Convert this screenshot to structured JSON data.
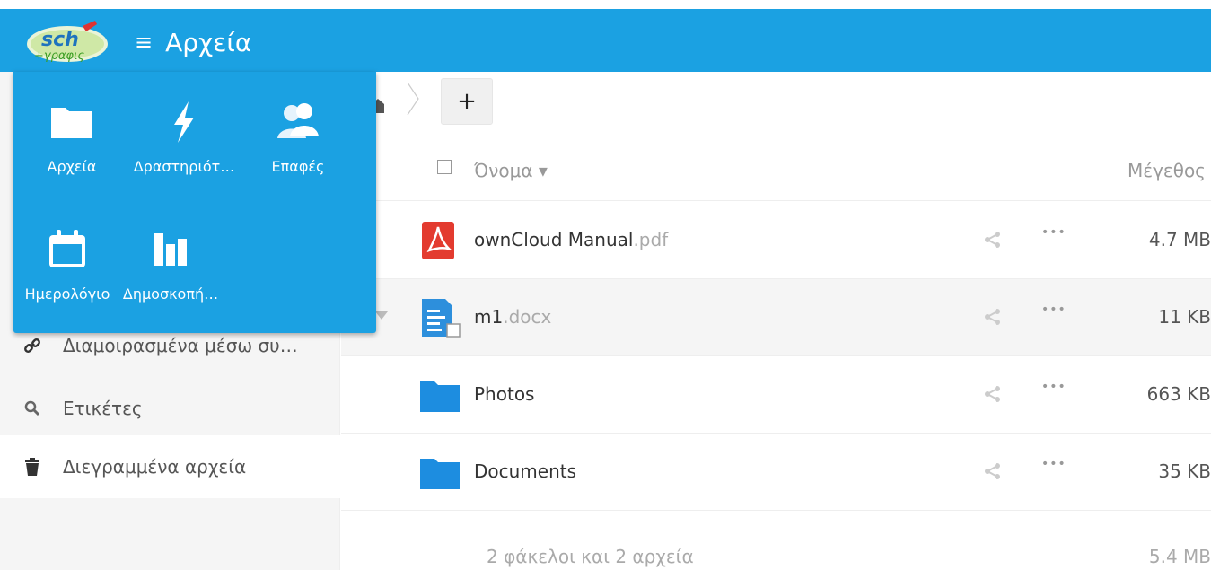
{
  "header": {
    "title": "Αρχεία",
    "menu_icon": "hamburger-icon",
    "logo_text": "sch+γραφις",
    "color": "#1ba1e2"
  },
  "app_menu": {
    "apps": [
      {
        "label": "Αρχεία",
        "icon": "folder-icon"
      },
      {
        "label": "Δραστηριότ…",
        "icon": "lightning-icon"
      },
      {
        "label": "Επαφές",
        "icon": "contacts-icon"
      },
      {
        "label": "Ημερολόγιο",
        "icon": "calendar-icon"
      },
      {
        "label": "Δημοσκοπή…",
        "icon": "poll-icon"
      }
    ]
  },
  "sidebar": {
    "items": [
      {
        "label": "Διαμοιρασμένα μέσω συ…",
        "icon": "link-icon"
      },
      {
        "label": "Ετικέτες",
        "icon": "search-icon"
      },
      {
        "label": "Διεγραμμένα αρχεία",
        "icon": "trash-icon"
      }
    ]
  },
  "toolbar": {
    "add_label": "+"
  },
  "table": {
    "header": {
      "name": "Όνομα ▾",
      "size": "Μέγεθος"
    },
    "rows": [
      {
        "name": "ownCloud Manual",
        "ext": ".pdf",
        "size": "4.7 MB",
        "icon": "pdf-icon",
        "more": "•••"
      },
      {
        "name": "m1",
        "ext": ".docx",
        "size": "11 KB",
        "icon": "document-icon",
        "more": "•••"
      },
      {
        "name": "Photos",
        "ext": "",
        "size": "663 KB",
        "icon": "folder-icon",
        "more": "•••"
      },
      {
        "name": "Documents",
        "ext": "",
        "size": "35 KB",
        "icon": "folder-icon",
        "more": "•••"
      }
    ],
    "summary": {
      "count": "2 φάκελοι και 2 αρχεία",
      "total": "5.4 MB"
    }
  }
}
